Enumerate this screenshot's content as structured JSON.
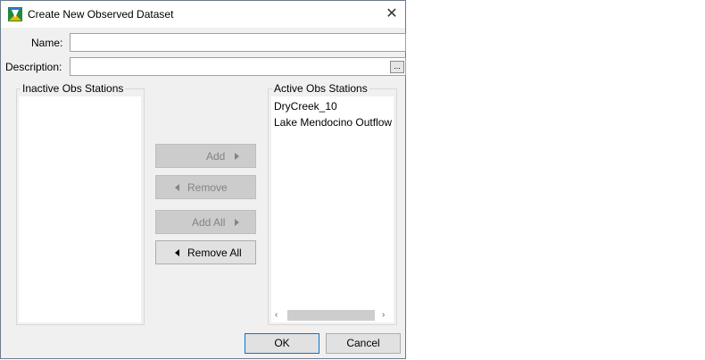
{
  "window": {
    "title": "Create New Observed Dataset",
    "close_glyph": "✕"
  },
  "form": {
    "name_label": "Name:",
    "name_value": "",
    "description_label": "Description:",
    "description_value": "",
    "browse_label": "..."
  },
  "inactive": {
    "title": "Inactive Obs Stations",
    "items": []
  },
  "active": {
    "title": "Active Obs Stations",
    "items": [
      "DryCreek_10",
      "Lake Mendocino Outflow"
    ]
  },
  "actions": {
    "add": "Add",
    "remove": "Remove",
    "add_all": "Add All",
    "remove_all": "Remove All"
  },
  "footer": {
    "ok": "OK",
    "cancel": "Cancel"
  },
  "icons": {
    "app": "app-logo-icon",
    "close": "close-icon",
    "arrow_right": "caret-right-icon",
    "arrow_left": "caret-left-icon",
    "scroll_left": "scroll-left-arrow-icon",
    "scroll_right": "scroll-right-arrow-icon"
  },
  "colors": {
    "accent": "#0078d7",
    "dialog_bg": "#f0f0f0",
    "disabled_button": "#cccccc"
  }
}
